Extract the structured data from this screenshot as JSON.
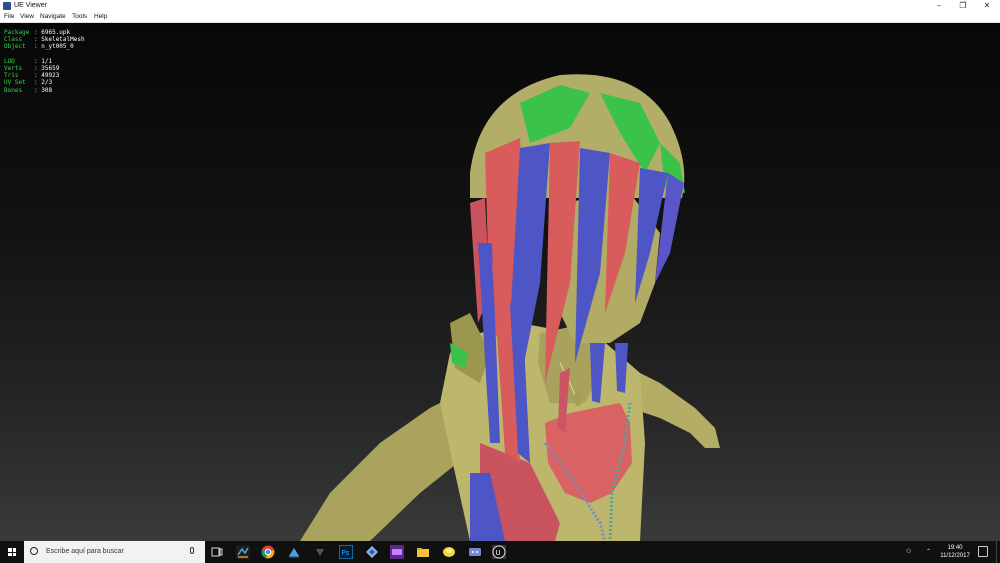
{
  "window": {
    "title": "UE Viewer",
    "icon": "app-icon",
    "controls": [
      "minimize-icon",
      "maximize-icon",
      "close-icon"
    ]
  },
  "menu": {
    "items": [
      {
        "label": "File"
      },
      {
        "label": "View"
      },
      {
        "label": "Navigate"
      },
      {
        "label": "Tools"
      },
      {
        "label": "Help"
      }
    ]
  },
  "info": {
    "object_block": [
      {
        "key": "Package",
        "value": "6965.upk"
      },
      {
        "key": "Class",
        "value": "SkeletalMesh"
      },
      {
        "key": "Object",
        "value": "n_yt005_0"
      }
    ],
    "mesh_block": [
      {
        "key": "LOD",
        "value": "1/1"
      },
      {
        "key": "Verts",
        "value": "35659"
      },
      {
        "key": "Tris",
        "value": "49923"
      },
      {
        "key": "UV Set",
        "value": "2/3"
      },
      {
        "key": "Bones",
        "value": "308"
      }
    ],
    "separator": ":",
    "key_color": "#34d34a",
    "value_color": "#ffffff"
  },
  "viewport": {
    "content": "3d-character-mesh",
    "mesh_colors": {
      "skin": "#b8b26a",
      "red": "#d85c5c",
      "blue": "#4e55c4",
      "green": "#33c24a"
    }
  },
  "taskbar": {
    "search_placeholder": "Escribe aquí para buscar",
    "apps": [
      "task-view-icon",
      "app-icon-1",
      "chrome-icon",
      "app-icon-3",
      "app-icon-4",
      "photoshop-icon",
      "app-icon-6",
      "app-icon-7",
      "file-explorer-icon",
      "app-icon-9",
      "app-icon-10",
      "unreal-icon"
    ],
    "tray": {
      "time": "19:40",
      "date": "11/12/2017"
    }
  }
}
